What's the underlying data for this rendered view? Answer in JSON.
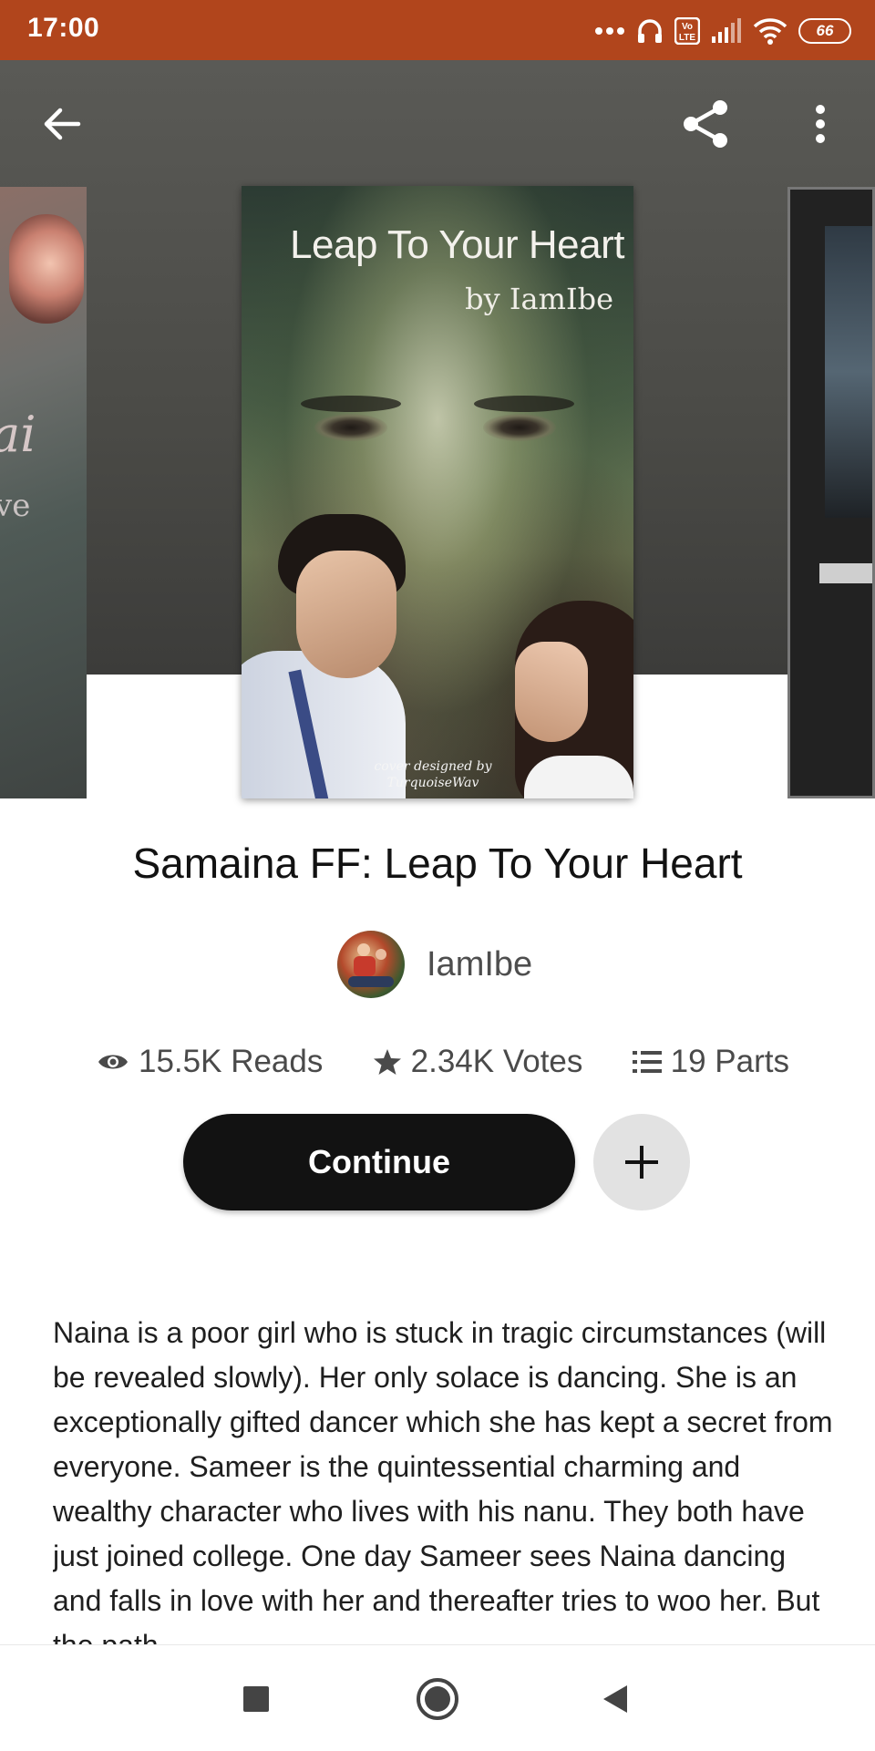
{
  "status_bar": {
    "time": "17:00",
    "battery": "66",
    "icons": [
      "more-dots-icon",
      "headphones-icon",
      "volte-icon",
      "signal-icon",
      "wifi-icon",
      "battery-icon"
    ]
  },
  "toolbar": {
    "icons": [
      "back-arrow-icon",
      "share-icon",
      "more-vertical-icon"
    ]
  },
  "cover": {
    "title": "Leap To Your Heart",
    "by_line": "by IamIbe",
    "credit_line1": "cover designed by",
    "credit_line2": "TurquoiseWav"
  },
  "story": {
    "title": "Samaina FF: Leap To Your Heart",
    "author": "IamIbe"
  },
  "stats": {
    "reads": "15.5K Reads",
    "votes": "2.34K Votes",
    "parts": "19 Parts"
  },
  "actions": {
    "continue_label": "Continue",
    "add_icon": "plus-icon"
  },
  "description": "Naina is a poor girl who is stuck in tragic circumstances (will be revealed slowly). Her only solace is dancing. She is an exceptionally gifted dancer which she has kept a secret from everyone. Sameer is the quintessential charming and wealthy character who lives with his nanu. They both have just joined college. One day Sameer sees Naina dancing and falls in love with her and thereafter tries to woo her. But the path",
  "nav_bar": {
    "icons": [
      "recents-square-icon",
      "home-circle-icon",
      "back-triangle-icon"
    ]
  },
  "colors": {
    "status_bar": "#b1451c",
    "primary_button": "#121212",
    "secondary_button": "#e2e2e2"
  }
}
